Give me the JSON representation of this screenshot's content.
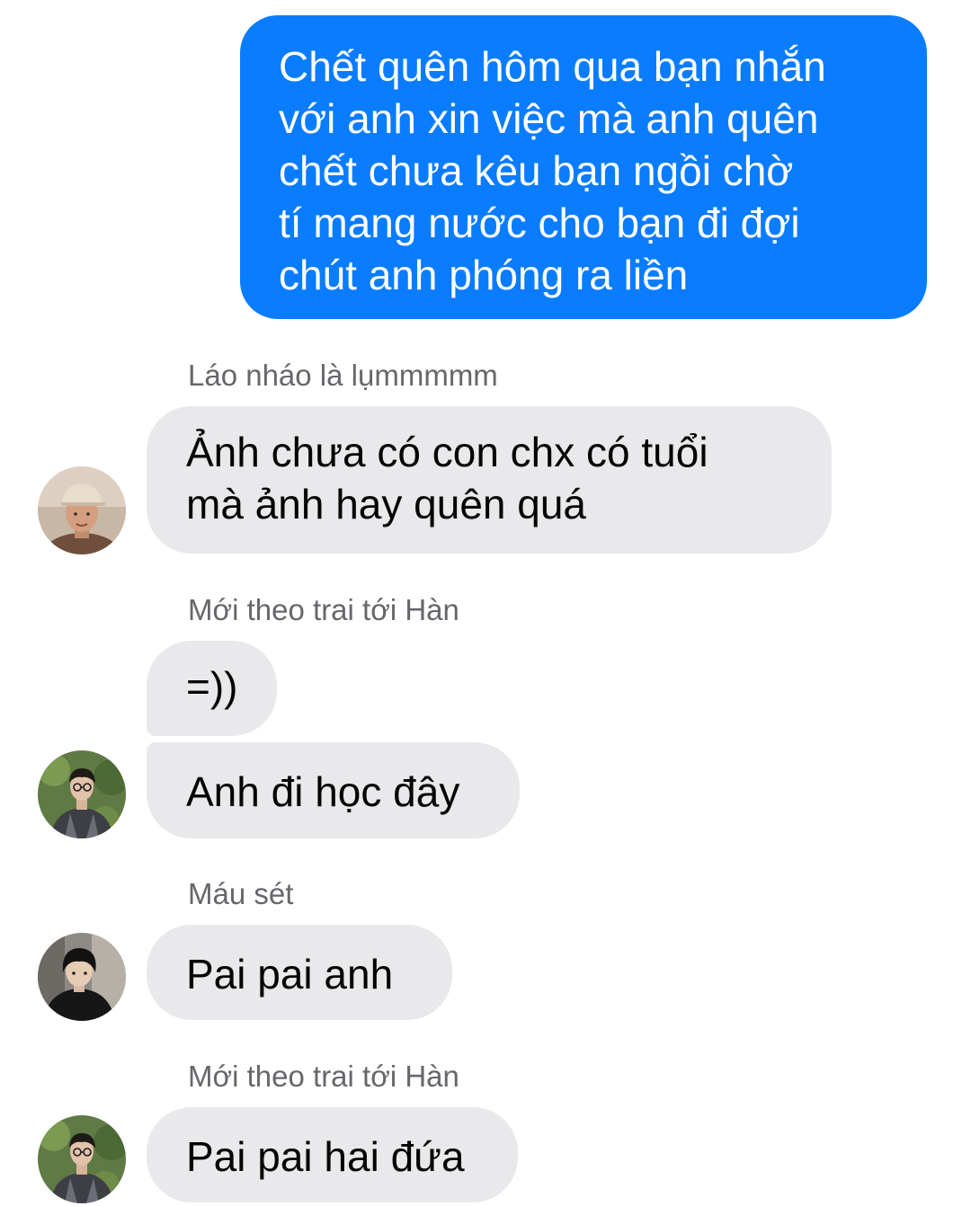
{
  "conversation": {
    "outgoing_message": {
      "lines": [
        "Chết quên hôm qua bạn nhắn",
        "với anh xin việc mà anh quên",
        "chết chưa kêu bạn ngồi chờ",
        "tí mang nước cho bạn đi đợi",
        "chút anh phóng ra liền"
      ]
    },
    "groups": [
      {
        "sender": "Láo nháo là lụmmmmm",
        "avatar": "user-photo-cap-avatar",
        "messages": [
          {
            "lines": [
              "Ảnh chưa có con chx có tuổi",
              "mà ảnh hay quên quá"
            ]
          }
        ]
      },
      {
        "sender": "Mới theo trai tới Hàn",
        "avatar": "user-photo-glasses-avatar",
        "messages": [
          {
            "lines": [
              "=))"
            ]
          },
          {
            "lines": [
              "Anh đi học đây"
            ]
          }
        ]
      },
      {
        "sender": "Máu sét",
        "avatar": "user-photo-dark-hair-avatar",
        "messages": [
          {
            "lines": [
              "Pai pai anh"
            ]
          }
        ]
      },
      {
        "sender": "Mới theo trai tới Hàn",
        "avatar": "user-photo-glasses-avatar",
        "messages": [
          {
            "lines": [
              "Pai pai hai đứa"
            ]
          }
        ]
      }
    ]
  },
  "colors": {
    "outgoing_bubble": "#0a7cff",
    "incoming_bubble": "#e9e9eb",
    "sender_name": "#65676b",
    "text": "#050505"
  }
}
